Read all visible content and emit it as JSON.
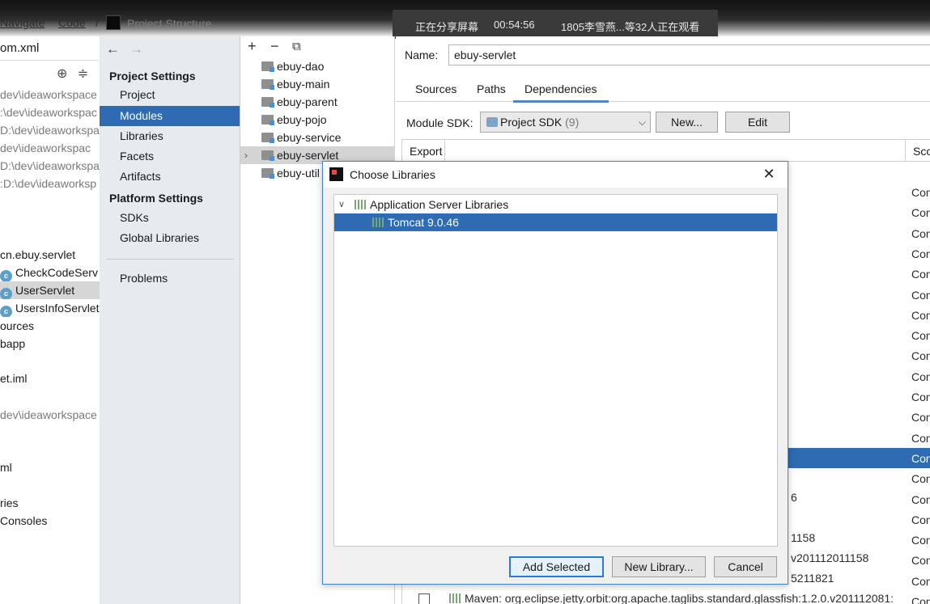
{
  "menu": {
    "navigate": "Navigate",
    "code": "Code",
    "window_title": "Project Structure"
  },
  "share_banner": {
    "status": "正在分享屏幕",
    "time": "00:54:56",
    "viewers": "1805李雪燕...等32人正在观看"
  },
  "project_tree": {
    "header_file": "om.xml",
    "rows": [
      {
        "text": "dev\\ideaworkspace",
        "kind": "path"
      },
      {
        "text": ":\\dev\\ideaworkspac",
        "kind": "path"
      },
      {
        "text": "D:\\dev\\ideaworkspa",
        "kind": "path"
      },
      {
        "text": "dev\\ideaworkspac",
        "kind": "path"
      },
      {
        "text": "D:\\dev\\ideaworkspa",
        "kind": "path"
      },
      {
        "text": ":D:\\dev\\ideaworksp",
        "kind": "path"
      },
      {
        "text": "cn.ebuy.servlet",
        "kind": "text"
      },
      {
        "text": "CheckCodeServ",
        "kind": "class"
      },
      {
        "text": "UserServlet",
        "kind": "class-selected"
      },
      {
        "text": "UsersInfoServlet",
        "kind": "class"
      },
      {
        "text": "ources",
        "kind": "text"
      },
      {
        "text": "bapp",
        "kind": "text"
      },
      {
        "text": "et.iml",
        "kind": "text"
      },
      {
        "text": "dev\\ideaworkspace",
        "kind": "path"
      },
      {
        "text": "ml",
        "kind": "text"
      },
      {
        "text": "ries",
        "kind": "text"
      },
      {
        "text": " Consoles",
        "kind": "text"
      }
    ]
  },
  "settings_nav": {
    "project_settings": "Project Settings",
    "project_items": [
      "Project",
      "Modules",
      "Libraries",
      "Facets",
      "Artifacts"
    ],
    "platform_settings": "Platform Settings",
    "platform_items": [
      "SDKs",
      "Global Libraries"
    ],
    "problems": "Problems",
    "selected": "Modules"
  },
  "modules": {
    "items": [
      "ebuy-dao",
      "ebuy-main",
      "ebuy-parent",
      "ebuy-pojo",
      "ebuy-service",
      "ebuy-servlet",
      "ebuy-util"
    ],
    "selected": "ebuy-servlet"
  },
  "details": {
    "name_label": "Name:",
    "name_value": "ebuy-servlet",
    "tabs": [
      "Sources",
      "Paths",
      "Dependencies"
    ],
    "active_tab": "Dependencies",
    "sdk_label": "Module SDK:",
    "sdk_value": "Project SDK",
    "sdk_count": "(9)",
    "new_button": "New...",
    "edit_button": "Edit",
    "col_export": "Export",
    "col_scope": "Sco",
    "scope_values": [
      "Con",
      "Con",
      "Con",
      "Con",
      "Con",
      "Con",
      "Con",
      "Con",
      "Con",
      "Con",
      "Con",
      "Con",
      "Con",
      "Con",
      "Con",
      "Con",
      "Con",
      "Con",
      "Con",
      "Con",
      "Con"
    ],
    "row_fragments": [
      "6",
      "1158",
      "v201112011158",
      "5211821"
    ],
    "last_dependency": "Maven: org.eclipse.jetty.orbit:org.apache.taglibs.standard.glassfish:1.2.0.v201112081:"
  },
  "dialog": {
    "title": "Choose Libraries",
    "group": "Application Server Libraries",
    "library": "Tomcat 9.0.46",
    "add_selected": "Add Selected",
    "new_library": "New Library...",
    "cancel": "Cancel"
  },
  "colors": {
    "selection": "#2e6bb3",
    "nav_background": "#e6ebf0",
    "dialog_border": "#3f86d0"
  }
}
